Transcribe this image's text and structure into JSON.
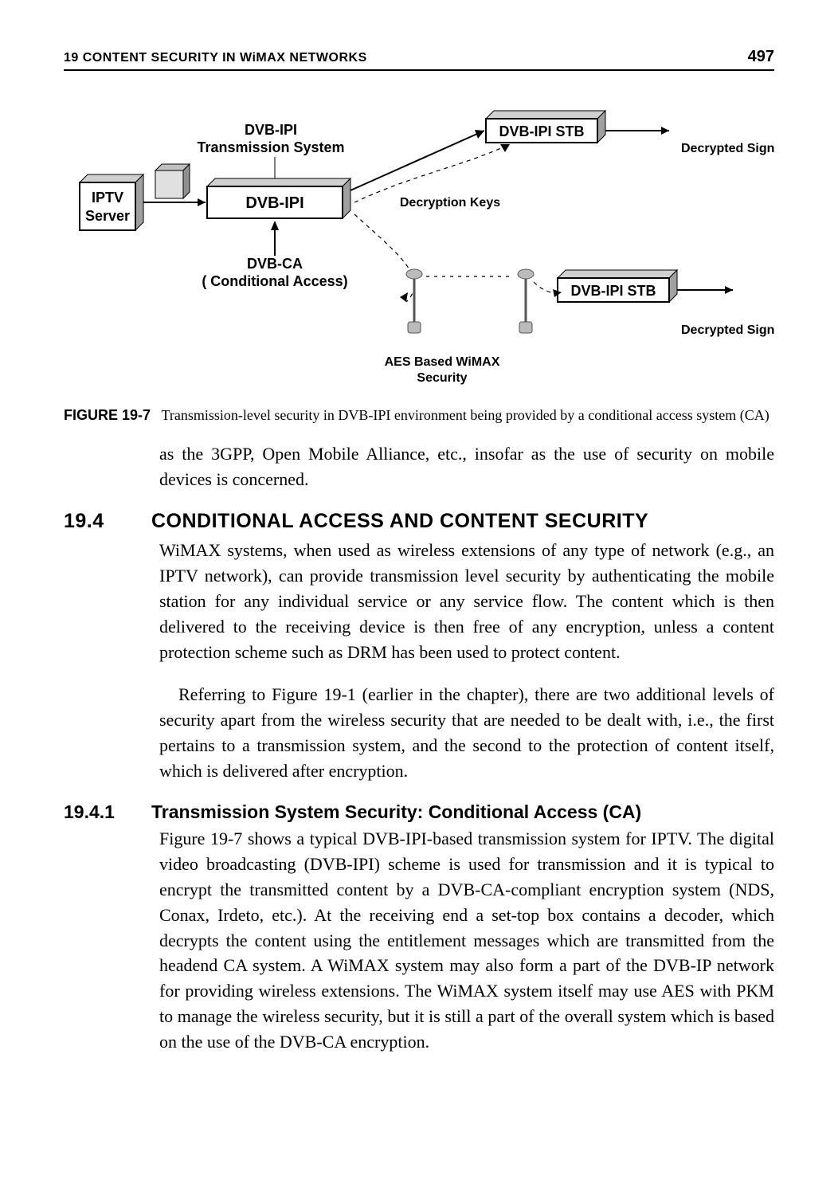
{
  "header": {
    "left": "19  CONTENT SECURITY IN WiMAX NETWORKS",
    "page_number": "497"
  },
  "figure": {
    "caption_label": "FIGURE 19-7",
    "caption_text": "Transmission-level security in DVB-IPI environment being provided by a conditional access system (CA)",
    "nodes": {
      "iptv_server_l1": "IPTV",
      "iptv_server_l2": "Server",
      "dvb_ipi_ts_l1": "DVB-IPI",
      "dvb_ipi_ts_l2": "Transmission System",
      "dvb_ipi_box": "DVB-IPI",
      "dvb_ca_l1": "DVB-CA",
      "dvb_ca_l2": "( Conditional Access)",
      "decryption_keys": "Decryption Keys",
      "stb1": "DVB-IPI STB",
      "stb2": "DVB-IPI STB",
      "decrypted_signal_1": "Decrypted Signal",
      "decrypted_signal_2": "Decrypted Signal",
      "aes_l1": "AES Based WiMAX",
      "aes_l2": "Security"
    }
  },
  "paragraphs": {
    "lead_in": "as the 3GPP, Open Mobile Alliance, etc., insofar as the use of security on mobile devices is concerned.",
    "s194_num": "19.4",
    "s194_title": "CONDITIONAL ACCESS AND CONTENT SECURITY",
    "s194_p1": "WiMAX systems, when used as wireless extensions of any type of network (e.g., an IPTV network), can provide transmission level security by authenticating the mobile station for any individual service or any service flow. The content which is then delivered to the receiving device is then free of any encryption, unless a content protection scheme such as DRM has been used to protect content.",
    "s194_p2": "Referring to Figure 19-1 (earlier in the chapter), there are two additional levels of security apart from the wireless security that are needed to be dealt with, i.e., the first pertains to a transmission system, and the second to the protection of content itself, which is delivered after encryption.",
    "s1941_num": "19.4.1",
    "s1941_title": "Transmission System Security: Conditional Access (CA)",
    "s1941_p1": "Figure 19-7 shows a typical DVB-IPI-based transmission system for IPTV. The digital video broadcasting (DVB-IPI) scheme is used for transmission and it is typical to encrypt the transmitted content by a DVB-CA-compliant encryption system (NDS, Conax, Irdeto, etc.). At the receiving end a set-top box contains a decoder, which decrypts the content using the entitlement messages which are transmitted from the headend CA system. A WiMAX system may also form a part of the DVB-IP network for providing wireless extensions. The WiMAX system itself may use AES with PKM to manage the wireless security, but it is still a part of the overall system which is based on the use of the DVB-CA encryption."
  }
}
